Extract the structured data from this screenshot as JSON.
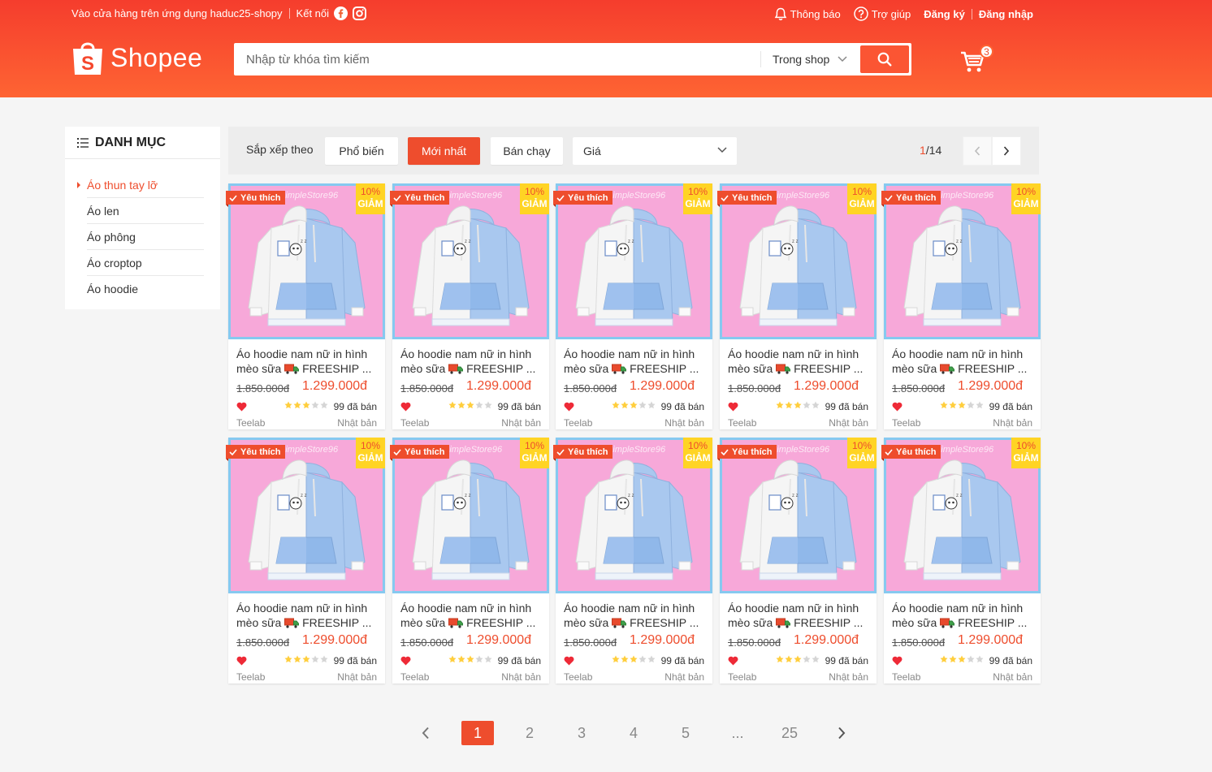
{
  "topbar": {
    "app_link": "Vào cửa hàng trên ứng dụng haduc25-shopy",
    "connect": "Kết nối",
    "notifications": "Thông báo",
    "help": "Trợ giúp",
    "register": "Đăng ký",
    "login": "Đăng nhập"
  },
  "logo": {
    "text": "Shopee"
  },
  "search": {
    "placeholder": "Nhập từ khóa tìm kiếm",
    "scope": "Trong shop"
  },
  "cart": {
    "count": "3"
  },
  "sidebar": {
    "title": "DANH MỤC",
    "items": [
      {
        "label": "Áo thun tay lỡ",
        "active": true
      },
      {
        "label": "Áo len",
        "active": false
      },
      {
        "label": "Áo phông",
        "active": false
      },
      {
        "label": "Áo croptop",
        "active": false
      },
      {
        "label": "Áo hoodie",
        "active": false
      }
    ]
  },
  "sortbar": {
    "label": "Sắp xếp theo",
    "popular": "Phổ biến",
    "newest": "Mới nhất",
    "bestseller": "Bán chạy",
    "price": "Giá",
    "page_current": "1",
    "page_total": "/14"
  },
  "product": {
    "favorite": "Yêu thích",
    "discount_pct": "10%",
    "discount_word": "GIẢM",
    "name_line1": "Áo hoodie nam nữ in hình",
    "name_line2_a": "mèo sữa",
    "name_line2_b": "FREESHIP ...",
    "old_price": "1.850.000đ",
    "new_price": "1.299.000đ",
    "rating": 3,
    "sold": "99 đã bán",
    "brand": "Teelab",
    "location": "Nhật bản",
    "watermark": "SimpleStore96"
  },
  "pagination": {
    "pages": [
      "1",
      "2",
      "3",
      "4",
      "5",
      "...",
      "25"
    ],
    "current": "1"
  },
  "colors": {
    "brand": "#ee4d2d",
    "header_top": "#f53d2d",
    "header_bottom": "#fe6433",
    "discount_badge": "#ffd424"
  }
}
